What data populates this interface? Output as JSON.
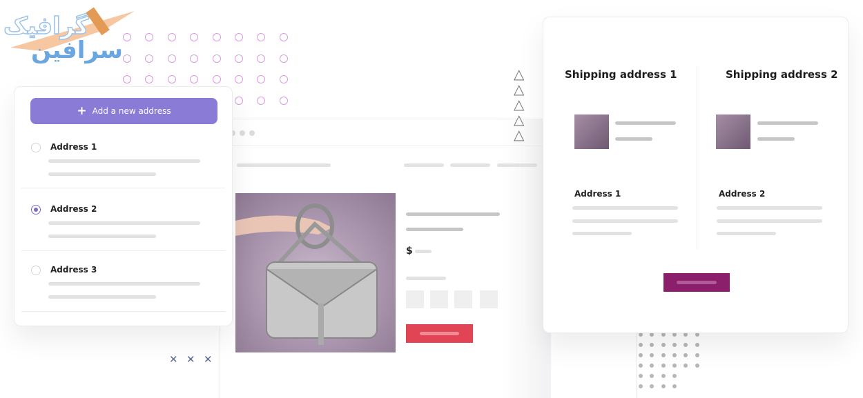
{
  "logo": {
    "text": "گرافیک سرافین"
  },
  "address_panel": {
    "add_button": "Add a new address",
    "add_icon": "plus-icon",
    "accent": "#8a7bd6",
    "items": [
      {
        "label": "Address 1",
        "selected": false
      },
      {
        "label": "Address 2",
        "selected": true
      },
      {
        "label": "Address 3",
        "selected": false
      }
    ]
  },
  "product": {
    "currency": "$",
    "add_button_color": "#e04455"
  },
  "shipping": {
    "columns": [
      {
        "title": "Shipping address 1",
        "address": "Address 1"
      },
      {
        "title": "Shipping address 2",
        "address": "Address 2"
      }
    ],
    "button_color": "#8c1f6b"
  }
}
